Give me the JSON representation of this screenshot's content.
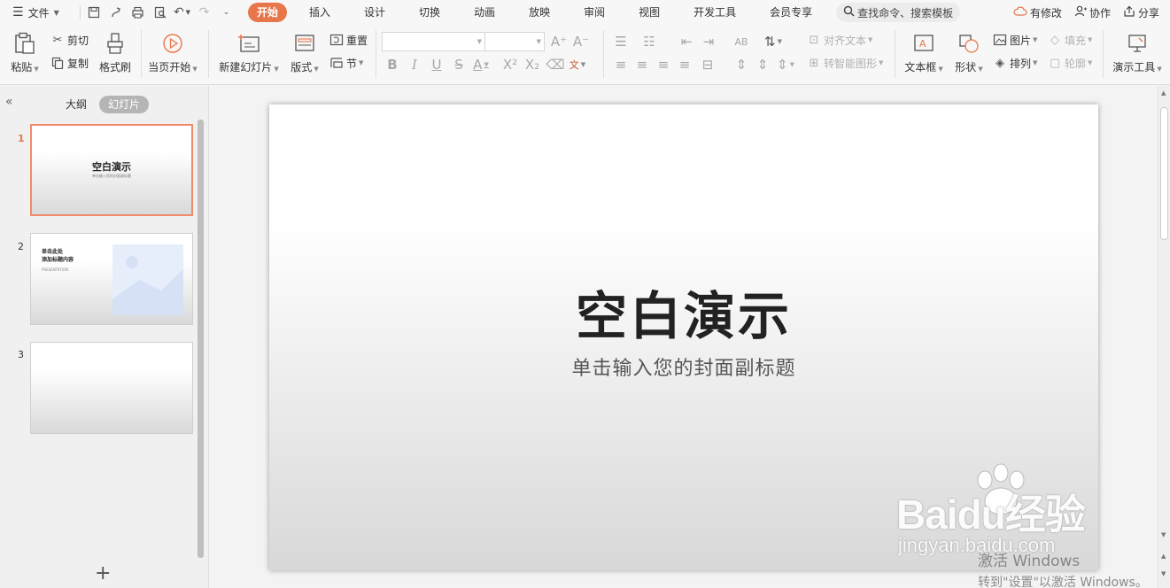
{
  "menubar": {
    "file_label": "文件",
    "tabs": [
      "开始",
      "插入",
      "设计",
      "切换",
      "动画",
      "放映",
      "审阅",
      "视图",
      "开发工具",
      "会员专享"
    ],
    "search_label": "查找命令、搜索模板",
    "right": {
      "modified": "有修改",
      "collab": "协作",
      "share": "分享"
    }
  },
  "ribbon": {
    "paste": "粘贴",
    "cut": "剪切",
    "copy": "复制",
    "format_painter": "格式刷",
    "from_current": "当页开始",
    "new_slide": "新建幻灯片",
    "layout": "版式",
    "reset": "重置",
    "section": "节",
    "font_name": "",
    "font_size": "",
    "align_text": "对齐文本",
    "smartart": "转智能图形",
    "textbox": "文本框",
    "shapes": "形状",
    "picture": "图片",
    "arrange": "排列",
    "fill": "填充",
    "outline": "轮廓",
    "present_tools": "演示工具"
  },
  "panel": {
    "tab_outline": "大纲",
    "tab_slides": "幻灯片",
    "slides": [
      {
        "num": "1",
        "title": "空白演示",
        "subtitle": "单击输入您的封面副标题"
      },
      {
        "num": "2",
        "title_line1": "单击此处",
        "title_line2": "添加标题内容",
        "subtitle": "PRESENTATION"
      },
      {
        "num": "3"
      }
    ],
    "add_label": "+"
  },
  "slide": {
    "title": "空白演示",
    "subtitle": "单击输入您的封面副标题"
  },
  "watermark": {
    "brand": "Baidu经验",
    "url": "jingyan.baidu.com",
    "activate_line1": "激活 Windows",
    "activate_line2": "转到\"设置\"以激活 Windows。"
  },
  "colors": {
    "accent": "#e8764b",
    "selected_border": "#f08b6a"
  }
}
